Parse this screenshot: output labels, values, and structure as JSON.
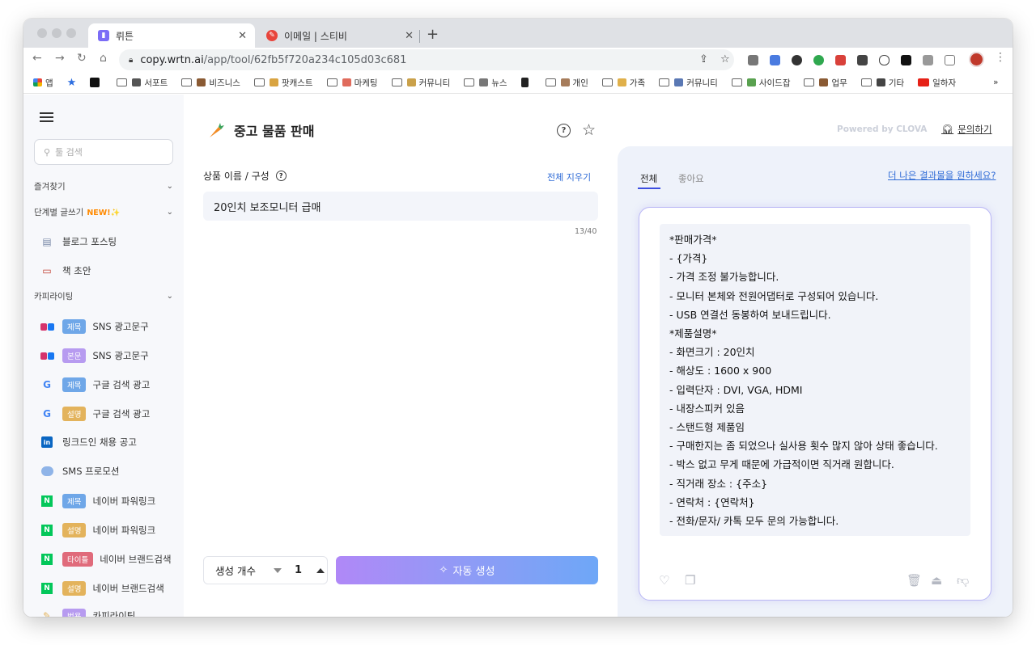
{
  "browser": {
    "tabs": [
      {
        "title": "뤼튼",
        "active": true,
        "favicon_color": "#7b6cf6"
      },
      {
        "title": "이메일 | 스티비",
        "active": false,
        "favicon_color": "#e8453c"
      }
    ],
    "url_host": "copy.wrtn.ai",
    "url_path": "/app/tool/62fb5f720a234c105d03c681",
    "bookmarks": [
      {
        "label": "앱",
        "icon": "apps-grid-icon"
      },
      {
        "label": "",
        "icon": "star-bookmark-icon"
      },
      {
        "label": "",
        "icon": "notion-icon"
      },
      {
        "label": "서포트",
        "icon": "folder-icon"
      },
      {
        "label": "비즈니스",
        "icon": "folder-icon"
      },
      {
        "label": "팟캐스트",
        "icon": "folder-icon"
      },
      {
        "label": "마케팅",
        "icon": "folder-icon"
      },
      {
        "label": "커뮤니티",
        "icon": "folder-icon"
      },
      {
        "label": "뉴스",
        "icon": "folder-icon"
      },
      {
        "label": "",
        "icon": "shopping-cart-icon"
      },
      {
        "label": "개인",
        "icon": "folder-icon"
      },
      {
        "label": "가족",
        "icon": "folder-icon"
      },
      {
        "label": "커뮤니티",
        "icon": "folder-icon"
      },
      {
        "label": "사이드잡",
        "icon": "folder-icon"
      },
      {
        "label": "업무",
        "icon": "folder-icon"
      },
      {
        "label": "기타",
        "icon": "folder-icon"
      },
      {
        "label": "일하자",
        "icon": "youtube-icon"
      }
    ],
    "bookmarks_more": "»"
  },
  "sidebar": {
    "search_placeholder": "툴 검색",
    "sections": {
      "favorites": "즐겨찾기",
      "step_writing": "단계별 글쓰기",
      "step_writing_new": "NEW!✨",
      "copywriting": "카피라이팅"
    },
    "step_items": [
      {
        "label": "블로그 포스팅",
        "icon": "document-icon"
      },
      {
        "label": "책 초안",
        "icon": "book-icon"
      }
    ],
    "copy_items": [
      {
        "label": "SNS 광고문구",
        "badge": "제목",
        "badge_color": "#6fa7e8",
        "icon": "instagram-facebook-icon"
      },
      {
        "label": "SNS 광고문구",
        "badge": "본문",
        "badge_color": "#b79bf0",
        "icon": "instagram-facebook-icon"
      },
      {
        "label": "구글 검색 광고",
        "badge": "제목",
        "badge_color": "#6fa7e8",
        "icon": "google-icon"
      },
      {
        "label": "구글 검색 광고",
        "badge": "설명",
        "badge_color": "#e3b35c",
        "icon": "google-icon"
      },
      {
        "label": "링크드인 채용 공고",
        "badge": "",
        "badge_color": "",
        "icon": "linkedin-icon"
      },
      {
        "label": "SMS 프로모션",
        "badge": "",
        "badge_color": "",
        "icon": "speech-bubble-icon"
      },
      {
        "label": "네이버 파워링크",
        "badge": "제목",
        "badge_color": "#6fa7e8",
        "icon": "naver-icon"
      },
      {
        "label": "네이버 파워링크",
        "badge": "설명",
        "badge_color": "#e3b35c",
        "icon": "naver-icon"
      },
      {
        "label": "네이버 브랜드검색",
        "badge": "타이틀",
        "badge_color": "#e06b7b",
        "icon": "naver-icon"
      },
      {
        "label": "네이버 브랜드검색",
        "badge": "설명",
        "badge_color": "#e3b35c",
        "icon": "naver-icon"
      },
      {
        "label": "카피라이팅",
        "badge": "범용",
        "badge_color": "#b79bf0",
        "icon": "pencil-icon"
      }
    ]
  },
  "tool": {
    "title": "중고 물품 판매",
    "field_label": "상품 이름 / 구성",
    "clear_all": "전체 지우기",
    "product_value": "20인치 보조모니터 급매",
    "char_count": "13/40",
    "gen_count_label": "생성 개수",
    "gen_count_value": "1",
    "generate_button": "자동 생성"
  },
  "results": {
    "powered_by": "Powered by CLOVA",
    "inquiry": "문의하기",
    "tabs": [
      "전체",
      "좋아요"
    ],
    "better_results": "더 나은 결과물을 원하세요?",
    "lines": [
      "*판매가격*",
      "- {가격}",
      "- 가격 조정 불가능합니다.",
      "- 모니터 본체와 전원어댑터로 구성되어 있습니다.",
      "- USB 연결선 동봉하여 보내드립니다.",
      "*제품설명*",
      "- 화면크기 : 20인치",
      "- 해상도 : 1600 x 900",
      "- 입력단자 : DVI, VGA, HDMI",
      "- 내장스피커 있음",
      "- 스탠드형 제품임",
      "- 구매한지는 좀 되었으나 실사용 횟수 많지 않아 상태 좋습니다.",
      "- 박스 없고 무게 때문에 가급적이면 직거래 원합니다.",
      "- 직거래 장소 : {주소}",
      "- 연락처 : {연락처}",
      "- 전화/문자/ 카톡 모두 문의 가능합니다."
    ]
  },
  "colors": {
    "accent_blue": "#2f6bd6",
    "generate_gradient_start": "#b088f7",
    "generate_gradient_end": "#6ea7f7",
    "card_border": "#b9b6f5"
  }
}
